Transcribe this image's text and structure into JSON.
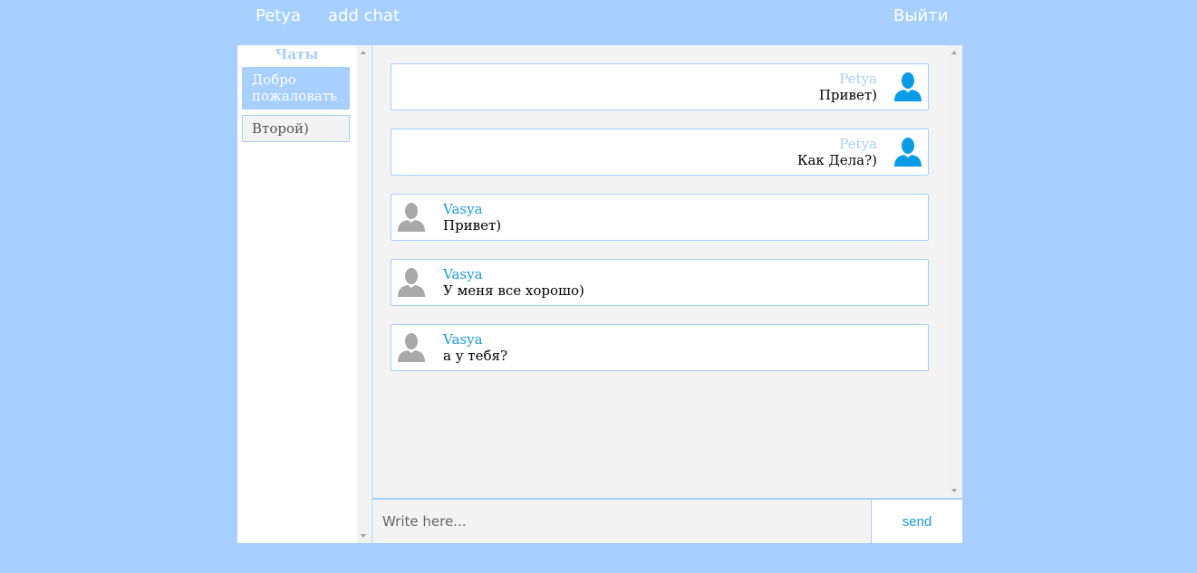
{
  "header": {
    "user": "Petya",
    "add_chat": "add chat",
    "logout": "Выйти"
  },
  "sidebar": {
    "title": "Чаты",
    "chats": [
      {
        "label": "Добро пожаловать",
        "active": true
      },
      {
        "label": "Второй)",
        "active": false
      }
    ]
  },
  "messages": [
    {
      "author": "Petya",
      "text": "Привет)",
      "direction": "outgoing"
    },
    {
      "author": "Petya",
      "text": "Как Дела?)",
      "direction": "outgoing"
    },
    {
      "author": "Vasya",
      "text": "Привет)",
      "direction": "incoming"
    },
    {
      "author": "Vasya",
      "text": "У меня все хорошо)",
      "direction": "incoming"
    },
    {
      "author": "Vasya",
      "text": "а у тебя?",
      "direction": "incoming"
    }
  ],
  "composer": {
    "placeholder": "Write here...",
    "value": "",
    "send_label": "send"
  },
  "icons": {
    "own_avatar": "user-avatar-icon",
    "other_avatar": "user-avatar-icon"
  },
  "colors": {
    "background": "#a7cfff",
    "accent": "#1a9bdb",
    "own_avatar": "#0a9be6",
    "other_avatar": "#a9a9a9"
  }
}
